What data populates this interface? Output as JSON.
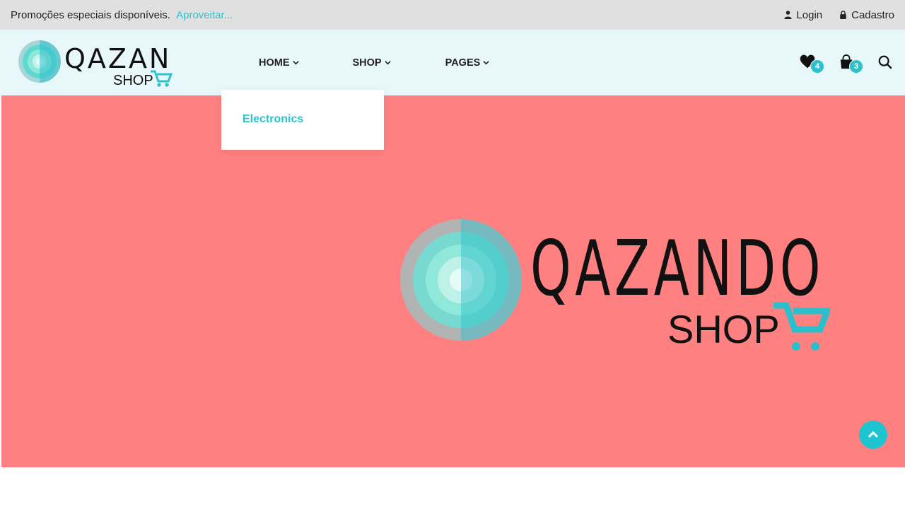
{
  "topbar": {
    "promo_text": "Promoções especiais disponíveis.",
    "promo_link": "Aproveitar...",
    "login_label": "Login",
    "signup_label": "Cadastro"
  },
  "brand": {
    "name": "Qazando",
    "sub": "SHOP",
    "accent_color": "#2ec1cc"
  },
  "nav": {
    "items": [
      {
        "label": "HOME"
      },
      {
        "label": "SHOP"
      },
      {
        "label": "PAGES"
      }
    ],
    "dropdown": {
      "items": [
        {
          "label": "Electronics"
        }
      ]
    }
  },
  "header_icons": {
    "wishlist_count": "4",
    "cart_count": "3"
  },
  "hero": {
    "background": "#ff8080"
  }
}
